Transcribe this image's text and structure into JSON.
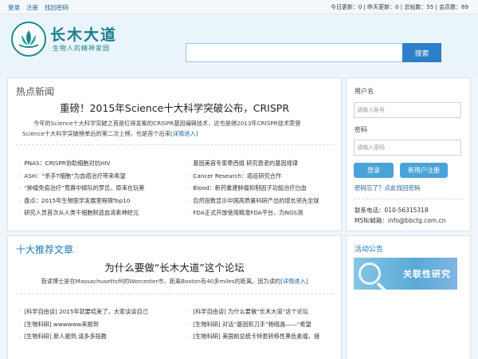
{
  "topbar": {
    "links": [
      "登录",
      "注册",
      "找回密码"
    ],
    "stats": "今日更新：0 | 昨天更新：0 | 总帖数：55 | 会员数：69"
  },
  "logo": {
    "title": "长木大道",
    "subtitle": "生物人的精神家园"
  },
  "search": {
    "placeholder": "",
    "button": "搜索"
  },
  "hot_news": {
    "title": "热点新闻",
    "headline": "重磅！2015年Science十大科学突破公布，CRISPR",
    "summary_line1": "今年的Science十大科学突破之首是红得发紫的CRISPR基因编辑技术，这也是继2013年CRISPR技术荣登",
    "summary_line2": "Science十大科学突破榜单后的第二次上榜，也是首个后来",
    "summary_link": "[详情进入]",
    "left_items": [
      "PNAS：CRISPR协助细胞对抗HIV",
      "ASH：“杀手T细胞”为血癌治疗带来希望",
      "“肿瘤免疫治疗”竞赛中掉队的罗氏，原来在玩第",
      "盘点：2015年生物医学发展里程碑Top10",
      "研究人员首次从人类干细胞制造血清素神经元"
    ],
    "right_items": [
      "基因美容专家牵西姐 研究衰老的基因规律",
      "Cancer Research：癌症研究合作",
      "Blood：新药重建肿瘤抑制因子功能治疗白血",
      "自然指数显示中国高质量科研产出的增长领先全球",
      "FDA正式开放使用精准FDA平台，为NGS测"
    ]
  },
  "recommend": {
    "title": "十大推荐文章",
    "headline": "为什么要做“长木大道”这个论坛",
    "summary": "我读博士是在Massachusetts州的Worcester市，距离Boston有40多miles的距离。因为读的",
    "summary_link": "[详情进入]",
    "left_items": [
      "[科学自由谈] 2015年就要结束了，大家谈谈自己",
      "[生物科研] wwwwww来报到",
      "[生物科研] 新人报到,请多多指教"
    ],
    "right_items": [
      "[科学自由谈] 为什么要做“长木大道”这个论坛",
      "[生物科研] 对话“基因剪刀手”杨晓晶——“希望",
      "[生物科研] 美国前总统卡特患转移性黑色素瘤，接"
    ]
  },
  "login": {
    "username_label": "用户名",
    "username_placeholder": "请输入账号",
    "password_label": "密码",
    "password_placeholder": "请输入密码",
    "login_button": "登录",
    "register_button": "新用户注册",
    "forgot_link": "密码忘了？点此找回密码",
    "phone": "联系电话：010-56315318",
    "email": "MSN/邮箱：info@bbctg.com.cn"
  },
  "announcement": {
    "title": "活动公告",
    "banner_text": "关联性研究"
  },
  "colors": {
    "accent": "#2c7fc8",
    "brand": "#1a7f88",
    "button": "#4aa3d8"
  }
}
